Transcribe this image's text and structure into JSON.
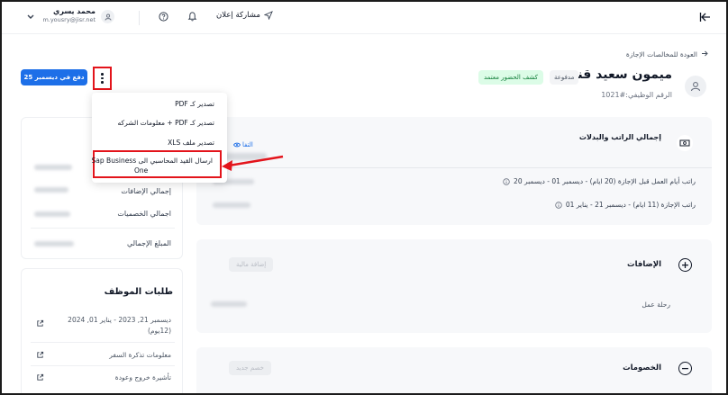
{
  "topbar": {
    "user_name": "محمد يسري",
    "user_email": "m.yousry@jisr.net",
    "share_label": "مشاركة إعلان"
  },
  "breadcrumb": {
    "back_label": "العودة للمخالصات الإجازة"
  },
  "actions": {
    "pay_button": "دفع في ديسمبر 25"
  },
  "employee": {
    "name": "ميمون سعيد قنيزع",
    "id_label": "الرقم الوظيفي:#1021",
    "badge_paid": "مدفوعة",
    "badge_attendance": "كشف الحضور معتمد"
  },
  "dropdown": {
    "items": [
      "تصدير كـ PDF",
      "تصدير كـ PDF + معلومات الشركه",
      "تصدير ملف XLS"
    ],
    "highlight_line1": "ارسال القيد المحاسبي الى Sap Business",
    "highlight_line2": "One"
  },
  "left_summary": {
    "additions": "إجمالي الإضافات",
    "deductions": "اجمالي الخصميات",
    "total": "المبلغ الإجمالي"
  },
  "requests": {
    "title": "طلبات الموظف",
    "items": [
      "ديسمبر 21, 2023 - يناير 01, 2024",
      "(12يوم)",
      "معلومات تذكرة السفر",
      "تأشيرة خروج وعودة"
    ]
  },
  "salary_card": {
    "title": "إجمالي الراتب والبدلات",
    "link": "التفا",
    "line1": "راتب أيام العمل قبل الإجازة (20 ايام) - ديسمبر 01 - ديسمبر 20",
    "line2": "راتب الإجازة (11 ايام) - ديسمبر 21 - يناير 01"
  },
  "additions_card": {
    "title": "الإضافات",
    "button": "إضافة مالية",
    "item": "رحلة عمل"
  },
  "deductions_card": {
    "title": "الخصومات",
    "button": "خصم جديد"
  },
  "icons": [
    "chevron-down-icon",
    "user-icon",
    "help-icon",
    "bell-icon",
    "send-icon",
    "collapse-icon",
    "arrow-right-icon",
    "kebab-icon",
    "salary-icon",
    "plus-icon",
    "minus-icon",
    "external-link-icon",
    "info-icon",
    "eye-icon"
  ],
  "colors": {
    "primary": "#1d6fe8",
    "highlight": "#e3141b",
    "success_bg": "#dcfce7",
    "success_text": "#15803d"
  }
}
